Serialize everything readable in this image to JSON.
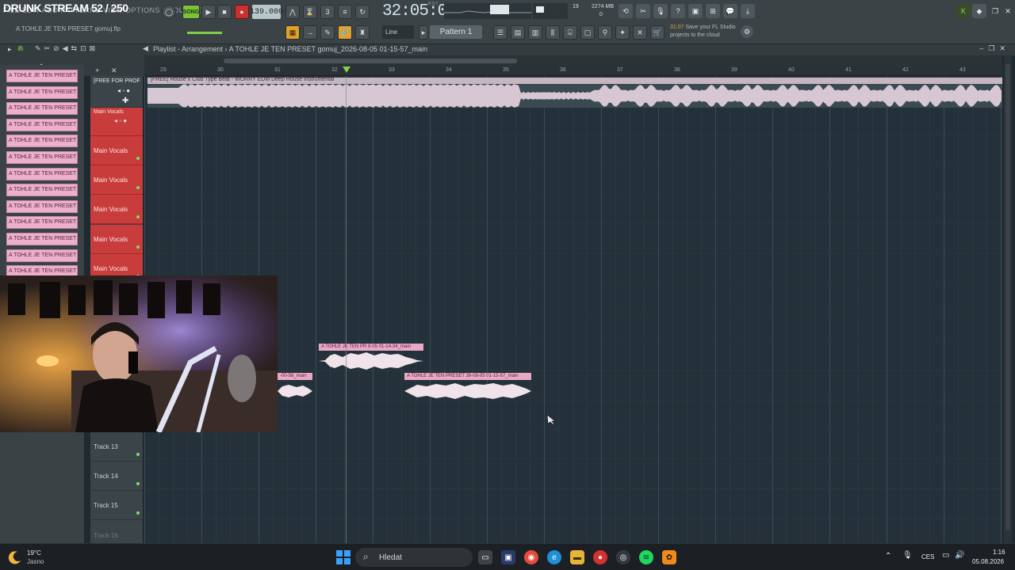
{
  "stream": {
    "title": "DRUNK STREAM 52 / 250"
  },
  "menu": {
    "text": "FILE EDIT ADD PATTERNS VIEW OPTIONS TOOLS HELP"
  },
  "project": {
    "file": "A TOHLE JE TEN PRESET gomuj.flp"
  },
  "transport": {
    "song_label": "SONG",
    "tempo": "139.000",
    "time": "32:05:03",
    "bst": "B:S:T",
    "cpu": "19",
    "memory": "2274 MB",
    "polyphony": "0"
  },
  "toolbar": {
    "snap": "Line",
    "pattern": "Pattern 1",
    "news_time": "31:07",
    "news_text": "Save your FL Studio projects to the cloud"
  },
  "playlist": {
    "title": "Playlist - Arrangement",
    "arrangement": "A TOHLE JE TEN PRESET gomuj_2026-08-05 01-15-57_main",
    "bar_numbers": [
      "29",
      "30",
      "31",
      "32",
      "33",
      "34",
      "35",
      "36",
      "37",
      "38",
      "39",
      "40",
      "41",
      "42",
      "43"
    ]
  },
  "patterns": {
    "item_label": "A TOHLE JE TEN PRESET g",
    "items": [
      "A TOHLE JE TEN PRESET g",
      "A TOHLE JE TEN PRESET g",
      "A TOHLE JE TEN PRESET g",
      "A TOHLE JE TEN PRESET g",
      "A TOHLE JE TEN PRESET g",
      "A TOHLE JE TEN PRESET g",
      "A TOHLE JE TEN PRESET g",
      "A TOHLE JE TEN PRESET g",
      "A TOHLE JE TEN PRESET g",
      "A TOHLE JE TEN PRESET g",
      "A TOHLE JE TEN PRESET g",
      "A TOHLE JE TEN PRESET g",
      "A TOHLE JE TEN PRESET g",
      "A TOHLE JE TEN PRESET g",
      "A TOHLE JE TEN PRESET g",
      "A TOHLE JE TEN PRESET g",
      "A TOHLE JE TEN PRESET g",
      "A TOHLE JE TEN PRESET g",
      "A TOHLE JE TEN PRESET g",
      "A TOHLE JE TEN PRESET g"
    ]
  },
  "tracks": {
    "free": "[FREE FOR PROF",
    "main_vocals_head": "Main Vocals",
    "main_vocals": [
      "Main Vocals",
      "Main Vocals",
      "Main Vocals",
      "Main Vocals",
      "Main Vocals"
    ],
    "lower": [
      "Track 13",
      "Track 14",
      "Track 15",
      "Track 16"
    ]
  },
  "clips": {
    "top_label": "[FREE] House x Club Type Beat - WORRY  EDM Deep House Instrumental",
    "clip_a": "A TOHLE JE TEN PR 8-05 01-14-34_main",
    "clip_b": "A TOHLE JE TEN PRESET  26-08-05 01-15-57_main",
    "clip_c": "-00-56_main"
  },
  "taskbar": {
    "temperature": "19°C",
    "weather": "Jasno",
    "search_placeholder": "Hledat",
    "language": "CES",
    "time": "1:16",
    "date": "05.08.2026"
  }
}
